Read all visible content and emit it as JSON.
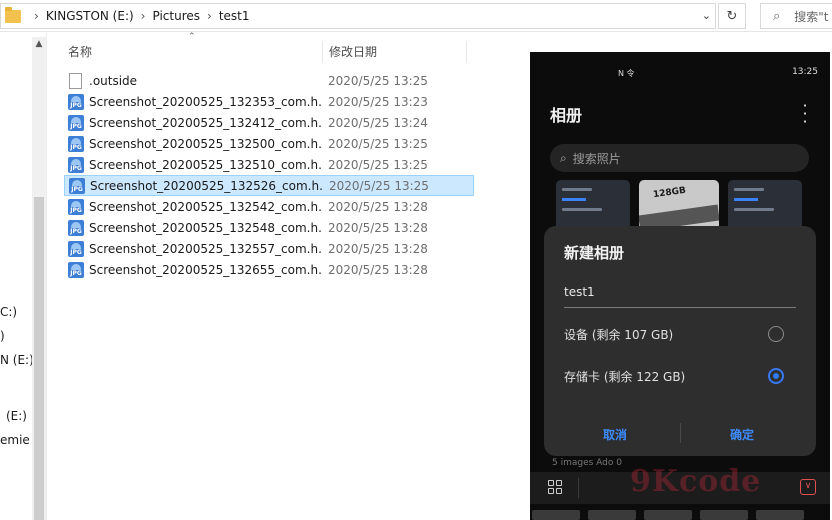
{
  "address": {
    "crumbs": [
      "KINGSTON (E:)",
      "Pictures",
      "test1"
    ],
    "search_placeholder": "搜索\"t"
  },
  "nav": {
    "items": [
      "C:)",
      ")",
      "N (E:)",
      "(E:)",
      "emie"
    ]
  },
  "columns": {
    "name": "名称",
    "date": "修改日期"
  },
  "files": [
    {
      "name": ".outside",
      "date": "2020/5/25 13:25",
      "type": "blank",
      "selected": false
    },
    {
      "name": "Screenshot_20200525_132353_com.h...",
      "date": "2020/5/25 13:23",
      "type": "jpg",
      "selected": false
    },
    {
      "name": "Screenshot_20200525_132412_com.h...",
      "date": "2020/5/25 13:24",
      "type": "jpg",
      "selected": false
    },
    {
      "name": "Screenshot_20200525_132500_com.h...",
      "date": "2020/5/25 13:25",
      "type": "jpg",
      "selected": false
    },
    {
      "name": "Screenshot_20200525_132510_com.h...",
      "date": "2020/5/25 13:25",
      "type": "jpg",
      "selected": false
    },
    {
      "name": "Screenshot_20200525_132526_com.h...",
      "date": "2020/5/25 13:25",
      "type": "jpg",
      "selected": true
    },
    {
      "name": "Screenshot_20200525_132542_com.h...",
      "date": "2020/5/25 13:28",
      "type": "jpg",
      "selected": false
    },
    {
      "name": "Screenshot_20200525_132548_com.h...",
      "date": "2020/5/25 13:28",
      "type": "jpg",
      "selected": false
    },
    {
      "name": "Screenshot_20200525_132557_com.h...",
      "date": "2020/5/25 13:28",
      "type": "jpg",
      "selected": false
    },
    {
      "name": "Screenshot_20200525_132655_com.h...",
      "date": "2020/5/25 13:28",
      "type": "jpg",
      "selected": false
    }
  ],
  "icon_label": "JPG",
  "phone": {
    "status_left": "N 令",
    "status_time": "13:25",
    "status_battery": "▮",
    "app_title": "相册",
    "search_placeholder": "搜索照片",
    "thumb_text": "128GB",
    "dialog": {
      "title": "新建相册",
      "input_value": "test1",
      "option_device": "设备 (剩余 107 GB)",
      "option_sd": "存储卡 (剩余 122 GB)",
      "selected": "sd",
      "cancel": "取消",
      "confirm": "确定"
    },
    "under_texts": "5          images  Ado    0",
    "watermark": "9Kcode"
  },
  "colors": {
    "selection_bg": "#cce8ff",
    "accent_blue": "#3478f6",
    "phone_bg": "#0c0c0c",
    "dialog_bg": "#2e2e2e"
  }
}
